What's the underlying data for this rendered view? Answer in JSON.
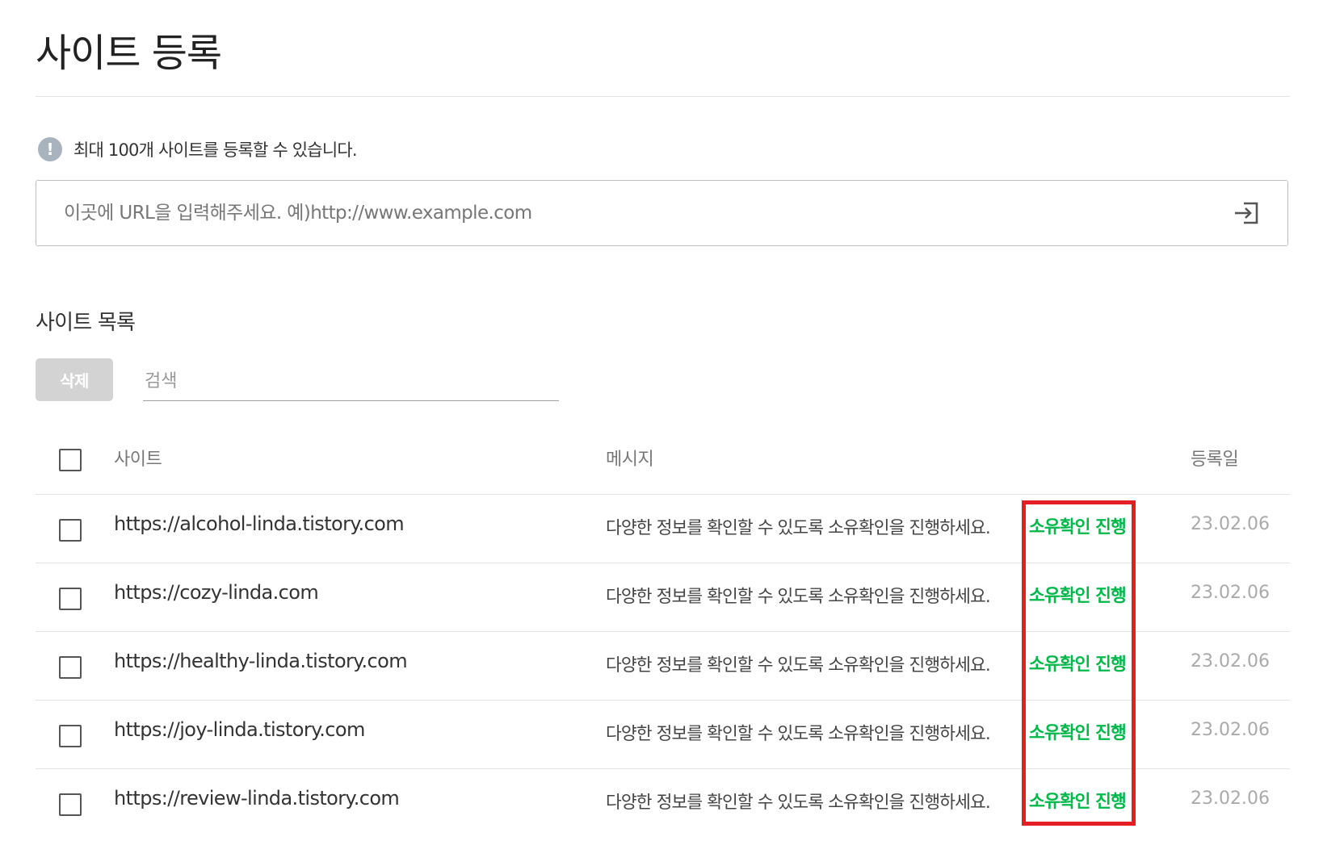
{
  "page": {
    "title": "사이트 등록"
  },
  "notice": {
    "icon": "info-icon",
    "text": "최대 100개 사이트를 등록할 수 있습니다."
  },
  "url_input": {
    "placeholder": "이곳에 URL을 입력해주세요. 예)http://www.example.com",
    "value": "",
    "submit_icon": "submit-arrow-icon"
  },
  "site_list": {
    "title": "사이트 목록",
    "delete_label": "삭제",
    "search_placeholder": "검색",
    "columns": {
      "site": "사이트",
      "message": "메시지",
      "date": "등록일"
    },
    "rows": [
      {
        "url": "https://alcohol-linda.tistory.com",
        "message": "다양한 정보를 확인할 수 있도록 소유확인을 진행하세요.",
        "action": "소유확인 진행",
        "date": "23.02.06"
      },
      {
        "url": "https://cozy-linda.com",
        "message": "다양한 정보를 확인할 수 있도록 소유확인을 진행하세요.",
        "action": "소유확인 진행",
        "date": "23.02.06"
      },
      {
        "url": "https://healthy-linda.tistory.com",
        "message": "다양한 정보를 확인할 수 있도록 소유확인을 진행하세요.",
        "action": "소유확인 진행",
        "date": "23.02.06"
      },
      {
        "url": "https://joy-linda.tistory.com",
        "message": "다양한 정보를 확인할 수 있도록 소유확인을 진행하세요.",
        "action": "소유확인 진행",
        "date": "23.02.06"
      },
      {
        "url": "https://review-linda.tistory.com",
        "message": "다양한 정보를 확인할 수 있도록 소유확인을 진행하세요.",
        "action": "소유확인 진행",
        "date": "23.02.06"
      }
    ]
  },
  "colors": {
    "accent_green": "#00b749",
    "highlight_red": "#e31e24",
    "delete_button_bg": "#d3d3d3"
  }
}
